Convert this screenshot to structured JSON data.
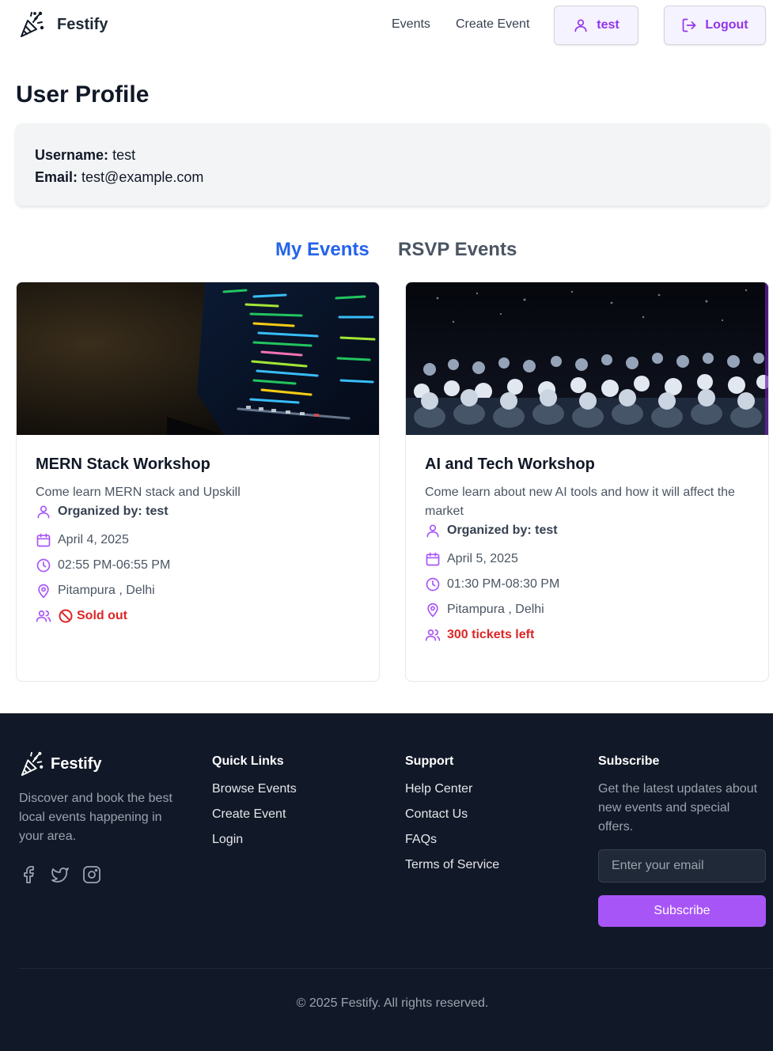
{
  "app": {
    "name": "Festify"
  },
  "nav": {
    "events": "Events",
    "create_event": "Create Event",
    "user_button": "test",
    "logout_button": "Logout"
  },
  "profile": {
    "title": "User Profile",
    "username_label": "Username:",
    "username_value": "test",
    "email_label": "Email:",
    "email_value": "test@example.com"
  },
  "tabs": [
    {
      "label": "My Events",
      "active": true
    },
    {
      "label": "RSVP Events",
      "active": false
    }
  ],
  "events": [
    {
      "title": "MERN Stack Workshop",
      "description": "Come learn MERN stack and Upskill",
      "organizer": "Organized by: test",
      "date": "April 4, 2025",
      "time": "02:55 PM-06:55 PM",
      "location": "Pitampura , Delhi",
      "availability": "Sold out",
      "availability_icon": "prohibited-icon",
      "image": "code-on-monitor"
    },
    {
      "title": "AI and Tech Workshop",
      "description": "Come learn about new AI tools and how it will affect the market",
      "organizer": "Organized by: test",
      "date": "April 5, 2025",
      "time": "01:30 PM-08:30 PM",
      "location": "Pitampura , Delhi",
      "availability": "300 tickets left",
      "image": "conference-audience"
    }
  ],
  "footer": {
    "brand": "Festify",
    "description": "Discover and book the best local events happening in your area.",
    "social_icons": [
      "facebook-icon",
      "twitter-icon",
      "instagram-icon"
    ],
    "quick_links": {
      "heading": "Quick Links",
      "items": [
        "Browse Events",
        "Create Event",
        "Login"
      ]
    },
    "support": {
      "heading": "Support",
      "items": [
        "Help Center",
        "Contact Us",
        "FAQs",
        "Terms of Service"
      ]
    },
    "subscribe": {
      "heading": "Subscribe",
      "text": "Get the latest updates about new events and special offers.",
      "placeholder": "Enter your email",
      "button": "Subscribe"
    },
    "copyright": "© 2025 Festify. All rights reserved."
  },
  "colors": {
    "accent": "#9333ea",
    "accent_button": "#a855f7",
    "active_tab": "#2563eb",
    "danger": "#dc2626",
    "footer_bg": "#111827"
  }
}
